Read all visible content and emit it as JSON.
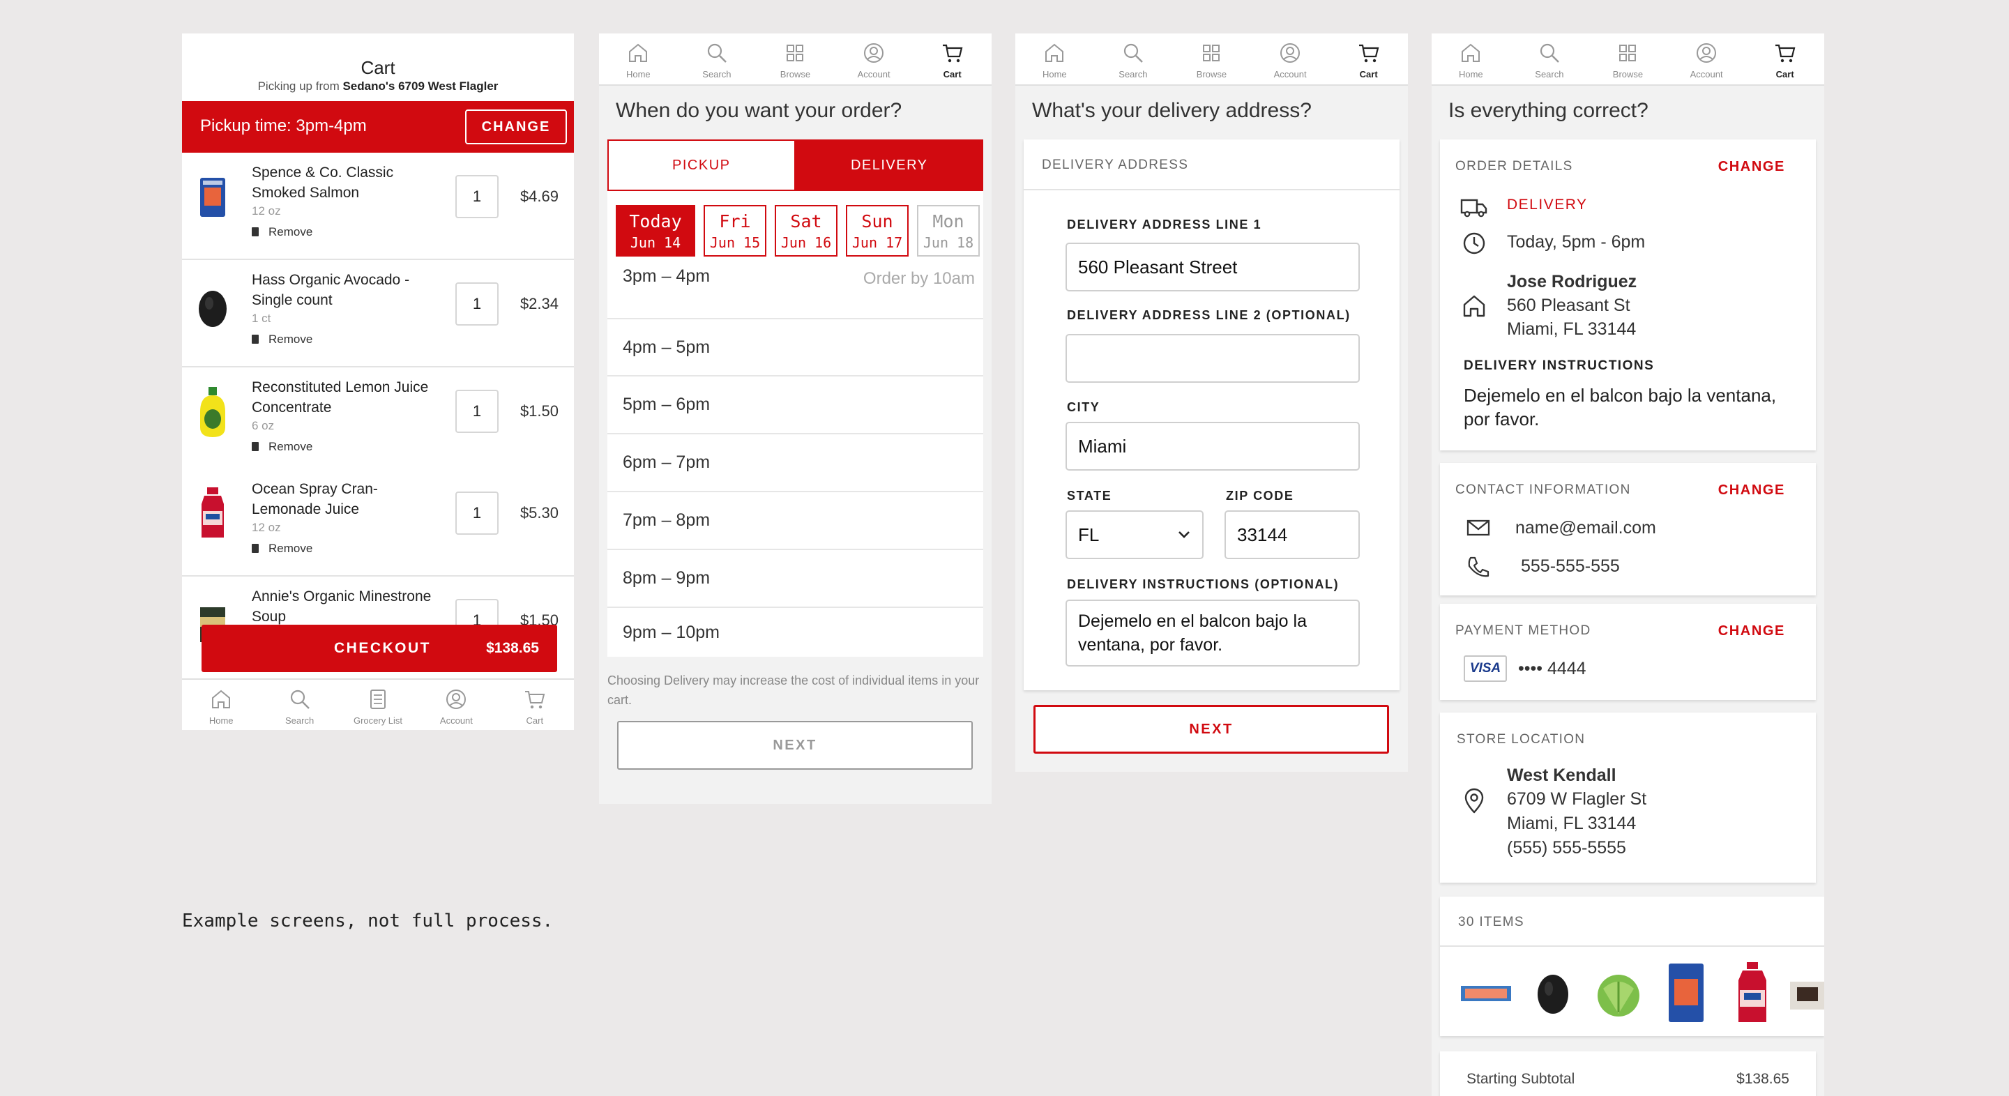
{
  "nav": {
    "home": "Home",
    "search": "Search",
    "browse": "Browse",
    "account": "Account",
    "cart": "Cart",
    "grocery_list": "Grocery List"
  },
  "cart_screen": {
    "title": "Cart",
    "pickup_prefix": "Picking up from ",
    "store_name": "Sedano's 6709 West Flagler",
    "pickup_time": "Pickup time: 3pm-4pm",
    "change_label": "CHANGE",
    "remove_label": "Remove",
    "items": [
      {
        "name": "Spence & Co. Classic Smoked Salmon",
        "size": "12 oz",
        "qty": "1",
        "price": "$4.69",
        "icon": "salmon-package-icon"
      },
      {
        "name": "Hass Organic Avocado - Single count",
        "size": "1 ct",
        "qty": "1",
        "price": "$2.34",
        "icon": "avocado-icon"
      },
      {
        "name": "Reconstituted Lemon Juice Concentrate",
        "size": "6 oz",
        "qty": "1",
        "price": "$1.50",
        "icon": "lemon-juice-icon"
      },
      {
        "name": "Ocean Spray Cran-Lemonade Juice",
        "size": "12 oz",
        "qty": "1",
        "price": "$5.30",
        "icon": "juice-bottle-icon"
      },
      {
        "name": "Annie's Organic Minestrone Soup",
        "size": "",
        "qty": "1",
        "price": "$1.50",
        "icon": "soup-can-icon"
      }
    ],
    "checkout_label": "CHECKOUT",
    "checkout_total": "$138.65"
  },
  "time_screen": {
    "question": "When do you want your order?",
    "tab_pickup": "PICKUP",
    "tab_delivery": "DELIVERY",
    "days": [
      {
        "name": "Today",
        "date": "Jun 14",
        "state": "selected"
      },
      {
        "name": "Fri",
        "date": "Jun 15",
        "state": "available"
      },
      {
        "name": "Sat",
        "date": "Jun 16",
        "state": "available"
      },
      {
        "name": "Sun",
        "date": "Jun 17",
        "state": "available"
      },
      {
        "name": "Mon",
        "date": "Jun 18",
        "state": "disabled"
      }
    ],
    "order_by": "Order by 10am",
    "slots": [
      "3pm – 4pm",
      "4pm – 5pm",
      "5pm – 6pm",
      "6pm – 7pm",
      "7pm – 8pm",
      "8pm – 9pm",
      "9pm – 10pm"
    ],
    "note": "Choosing Delivery may increase the cost of individual items in your cart.",
    "next_label": "NEXT"
  },
  "address_screen": {
    "question": "What's your delivery address?",
    "section_title": "DELIVERY ADDRESS",
    "line1_label": "DELIVERY ADDRESS LINE 1",
    "line1_value": "560 Pleasant Street",
    "line2_label": "DELIVERY ADDRESS LINE 2 (OPTIONAL)",
    "line2_value": "",
    "city_label": "CITY",
    "city_value": "Miami",
    "state_label": "STATE",
    "state_value": "FL",
    "zip_label": "ZIP CODE",
    "zip_value": "33144",
    "instructions_label": "DELIVERY INSTRUCTIONS (OPTIONAL)",
    "instructions_value": "Dejemelo en el balcon bajo la ventana, por favor.",
    "next_label": "NEXT"
  },
  "review_screen": {
    "question": "Is everything correct?",
    "change_label": "CHANGE",
    "order_details_title": "ORDER DETAILS",
    "delivery_label": "DELIVERY",
    "time_value": "Today, 5pm - 6pm",
    "customer_name": "Jose Rodriguez",
    "address_line1": "560 Pleasant St",
    "address_line2": "Miami, FL 33144",
    "instructions_title": "DELIVERY INSTRUCTIONS",
    "instructions_value": "Dejemelo en el balcon bajo la ventana, por favor.",
    "contact_title": "CONTACT INFORMATION",
    "email": "name@email.com",
    "phone": "555-555-555",
    "payment_title": "PAYMENT METHOD",
    "card_brand": "VISA",
    "card_number": "•••• 4444",
    "store_title": "STORE LOCATION",
    "store_name": "West Kendall",
    "store_address1": "6709 W Flagler St",
    "store_address2": "Miami, FL 33144",
    "store_phone": "(555) 555-5555",
    "items_title": "30 ITEMS",
    "item_icons": [
      "salmon-tray-icon",
      "avocado-icon",
      "cabbage-icon",
      "salmon-package-icon",
      "juice-bottle-icon",
      "box-icon"
    ],
    "subtotal_label": "Starting Subtotal",
    "subtotal_value": "$138.65"
  },
  "caption": "Example screens, not full process.",
  "colors": {
    "brand_red": "#d10a10",
    "background": "#ebe9e9"
  }
}
